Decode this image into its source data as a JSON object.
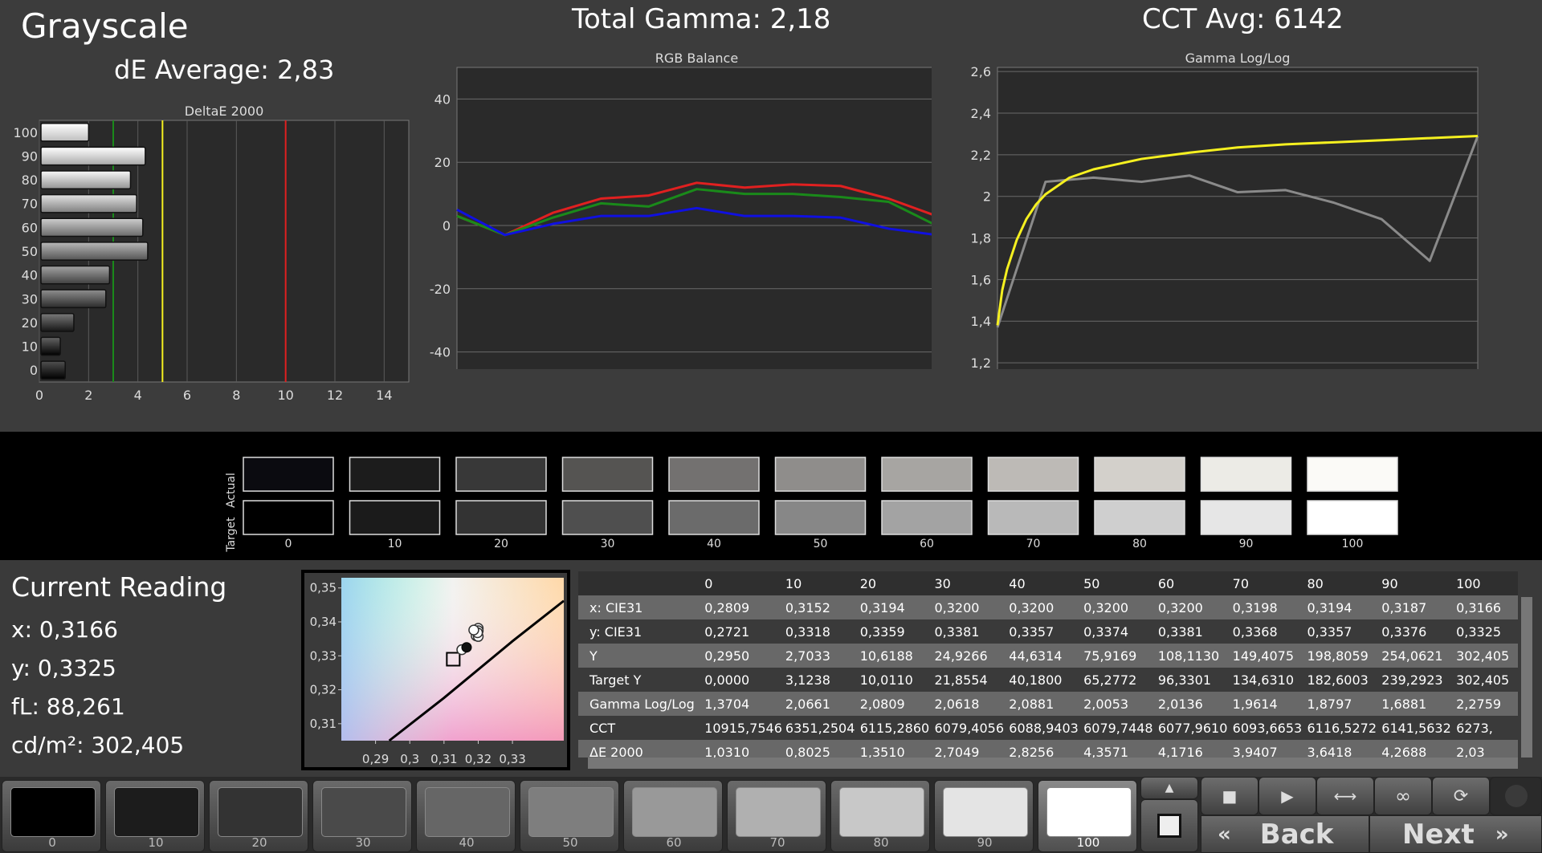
{
  "header": {
    "title": "Grayscale",
    "de_average": "dE Average: 2,83",
    "total_gamma": "Total Gamma: 2,18",
    "cct_avg": "CCT Avg: 6142"
  },
  "colors": {
    "red": "#e02020",
    "green": "#1a8a1a",
    "blue": "#1010e0",
    "yellow": "#f5f020",
    "gray_line": "#8a8a8a",
    "panel": "#3c3c3c",
    "plot_bg": "#2a2a2a"
  },
  "chart_data": [
    {
      "type": "bar",
      "orientation": "horizontal",
      "title": "DeltaE 2000",
      "categories": [
        "100",
        "90",
        "80",
        "70",
        "60",
        "50",
        "40",
        "30",
        "20",
        "10",
        "0"
      ],
      "values": [
        2.0,
        4.3,
        3.7,
        3.95,
        4.2,
        4.4,
        2.85,
        2.7,
        1.4,
        0.85,
        1.05
      ],
      "xticks": [
        "0",
        "2",
        "4",
        "6",
        "8",
        "10",
        "12",
        "14"
      ],
      "xlim": [
        0,
        15
      ],
      "reference_lines": [
        {
          "x": 3,
          "color": "green"
        },
        {
          "x": 5,
          "color": "yellow"
        },
        {
          "x": 10,
          "color": "red"
        }
      ]
    },
    {
      "type": "line",
      "title": "RGB Balance",
      "x": [
        0,
        10,
        20,
        30,
        40,
        50,
        60,
        70,
        80,
        90,
        100
      ],
      "series": [
        {
          "color": "red",
          "values": [
            3,
            -3,
            4,
            8.5,
            9.5,
            13.5,
            12,
            13,
            12.5,
            8.5,
            3
          ]
        },
        {
          "color": "green",
          "values": [
            3,
            -3,
            2.5,
            7,
            6,
            11.5,
            10,
            10,
            9,
            7.5,
            0
          ]
        },
        {
          "color": "blue",
          "values": [
            5,
            -3,
            0.5,
            3,
            3,
            5.5,
            3,
            3,
            2.5,
            -1,
            -3
          ]
        }
      ],
      "xlim": [
        0,
        100
      ],
      "ylim": [
        -50,
        50
      ],
      "xticks": [
        "0",
        "10",
        "20",
        "30",
        "40",
        "50",
        "60",
        "70",
        "80",
        "90",
        "100"
      ],
      "yticks": [
        "40",
        "20",
        "0",
        "-20",
        "-40"
      ],
      "grid": true
    },
    {
      "type": "line",
      "title": "Gamma Log/Log",
      "x": [
        0,
        10,
        20,
        30,
        40,
        50,
        60,
        70,
        80,
        90,
        100
      ],
      "series": [
        {
          "color": "gray",
          "values": [
            1.37,
            2.07,
            2.09,
            2.07,
            2.1,
            2.02,
            2.03,
            1.97,
            1.89,
            1.69,
            2.29
          ]
        },
        {
          "color": "yellow",
          "curve": "target",
          "x": [
            0,
            1,
            2,
            4,
            6,
            8,
            10,
            15,
            20,
            30,
            40,
            50,
            60,
            70,
            80,
            90,
            100
          ],
          "values": [
            1.38,
            1.55,
            1.65,
            1.79,
            1.89,
            1.96,
            2.01,
            2.09,
            2.13,
            2.18,
            2.21,
            2.235,
            2.25,
            2.26,
            2.27,
            2.28,
            2.29
          ]
        }
      ],
      "xlim": [
        0,
        100
      ],
      "ylim": [
        1.1,
        2.62
      ],
      "xticks": [
        "0",
        "10",
        "20",
        "30",
        "40",
        "50",
        "60",
        "70",
        "80",
        "90",
        "100"
      ],
      "yticks": [
        "2,6",
        "2,4",
        "2,2",
        "2",
        "1,8",
        "1,6",
        "1,4",
        "1,2"
      ],
      "grid": true
    },
    {
      "type": "scatter",
      "title": "",
      "xlim": [
        0.28,
        0.345
      ],
      "ylim": [
        0.305,
        0.353
      ],
      "xticks": [
        "0,29",
        "0,3",
        "0,31",
        "0,32",
        "0,33"
      ],
      "yticks": [
        "0,35",
        "0,34",
        "0,33",
        "0,32",
        "0,31"
      ],
      "target": {
        "x": 0.3127,
        "y": 0.329
      },
      "current": {
        "x": 0.3166,
        "y": 0.3325
      },
      "points": [
        {
          "x": 0.3152,
          "y": 0.3318
        },
        {
          "x": 0.3194,
          "y": 0.3359
        },
        {
          "x": 0.32,
          "y": 0.3381
        },
        {
          "x": 0.32,
          "y": 0.3357
        },
        {
          "x": 0.32,
          "y": 0.3374
        },
        {
          "x": 0.3198,
          "y": 0.3368
        },
        {
          "x": 0.3187,
          "y": 0.3376
        }
      ],
      "locus": [
        [
          0.294,
          0.305
        ],
        [
          0.31,
          0.3176
        ],
        [
          0.33,
          0.3343
        ],
        [
          0.345,
          0.3462
        ]
      ]
    }
  ],
  "swatches": {
    "row_labels": [
      "Actual",
      "Target"
    ],
    "levels": [
      "0",
      "10",
      "20",
      "30",
      "40",
      "50",
      "60",
      "70",
      "80",
      "90",
      "100"
    ],
    "actual_colors": [
      "#0b0b10",
      "#1c1c1c",
      "#383838",
      "#555452",
      "#737170",
      "#8f8d8b",
      "#a7a5a2",
      "#bdbab6",
      "#d3d0cb",
      "#ecebe6",
      "#fbfaf7"
    ],
    "target_colors": [
      "#000000",
      "#1b1b1b",
      "#333333",
      "#4f4f4f",
      "#6b6b6b",
      "#878787",
      "#a3a3a3",
      "#b9b9b9",
      "#cfcfcf",
      "#e6e6e6",
      "#ffffff"
    ]
  },
  "current_reading": {
    "title": "Current Reading",
    "x": "x: 0,3166",
    "y": "y: 0,3325",
    "fl": "fL: 88,261",
    "cdm2": "cd/m²: 302,405"
  },
  "table": {
    "columns": [
      "0",
      "10",
      "20",
      "30",
      "40",
      "50",
      "60",
      "70",
      "80",
      "90",
      "100"
    ],
    "rows": [
      {
        "label": "x: CIE31",
        "values": [
          "0,2809",
          "0,3152",
          "0,3194",
          "0,3200",
          "0,3200",
          "0,3200",
          "0,3200",
          "0,3198",
          "0,3194",
          "0,3187",
          "0,3166"
        ]
      },
      {
        "label": "y: CIE31",
        "values": [
          "0,2721",
          "0,3318",
          "0,3359",
          "0,3381",
          "0,3357",
          "0,3374",
          "0,3381",
          "0,3368",
          "0,3357",
          "0,3376",
          "0,3325"
        ]
      },
      {
        "label": "Y",
        "values": [
          "0,2950",
          "2,7033",
          "10,6188",
          "24,9266",
          "44,6314",
          "75,9169",
          "108,1130",
          "149,4075",
          "198,8059",
          "254,0621",
          "302,405"
        ]
      },
      {
        "label": "Target Y",
        "values": [
          "0,0000",
          "3,1238",
          "10,0110",
          "21,8554",
          "40,1800",
          "65,2772",
          "96,3301",
          "134,6310",
          "182,6003",
          "239,2923",
          "302,405"
        ]
      },
      {
        "label": "Gamma Log/Log",
        "values": [
          "1,3704",
          "2,0661",
          "2,0809",
          "2,0618",
          "2,0881",
          "2,0053",
          "2,0136",
          "1,9614",
          "1,8797",
          "1,6881",
          "2,2759"
        ]
      },
      {
        "label": "CCT",
        "values": [
          "10915,7546",
          "6351,2504",
          "6115,2860",
          "6079,4056",
          "6088,9403",
          "6079,7448",
          "6077,9610",
          "6093,6653",
          "6116,5272",
          "6141,5632",
          "6273,"
        ]
      },
      {
        "label": "ΔE 2000",
        "values": [
          "1,0310",
          "0,8025",
          "1,3510",
          "2,7049",
          "2,8256",
          "4,3571",
          "4,1716",
          "3,9407",
          "3,6418",
          "4,2688",
          "2,03"
        ]
      }
    ]
  },
  "patch_buttons": [
    {
      "label": "0",
      "color": "#000000"
    },
    {
      "label": "10",
      "color": "#1c1c1c"
    },
    {
      "label": "20",
      "color": "#333333"
    },
    {
      "label": "30",
      "color": "#4a4a4a"
    },
    {
      "label": "40",
      "color": "#666666"
    },
    {
      "label": "50",
      "color": "#7e7e7e"
    },
    {
      "label": "60",
      "color": "#999999"
    },
    {
      "label": "70",
      "color": "#b0b0b0"
    },
    {
      "label": "80",
      "color": "#c8c8c8"
    },
    {
      "label": "90",
      "color": "#e4e4e4"
    },
    {
      "label": "100",
      "color": "#ffffff",
      "selected": true
    }
  ],
  "nav": {
    "back_label": "Back",
    "next_label": "Next"
  },
  "icons": [
    "stop-icon",
    "play-icon",
    "fit-width-icon",
    "loop-icon",
    "refresh-icon",
    "chevron-up-icon",
    "stop-square-icon",
    "double-chevron-left-icon",
    "double-chevron-right-icon"
  ]
}
